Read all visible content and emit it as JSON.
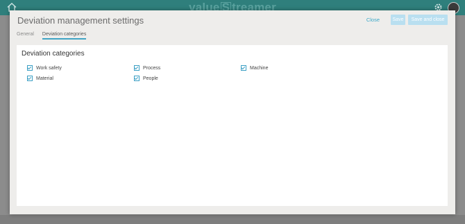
{
  "app": {
    "logo_left": "value",
    "logo_mid": "S",
    "logo_right": "treamer"
  },
  "modal": {
    "title": "Deviation management settings",
    "close_label": "Close",
    "save_label": "Save",
    "save_close_label": "Save and close",
    "tabs": [
      {
        "label": "General",
        "active": false
      },
      {
        "label": "Deviation categories",
        "active": true
      }
    ],
    "section_title": "Deviation categories",
    "categories": [
      {
        "label": "Work safety",
        "checked": true
      },
      {
        "label": "Process",
        "checked": true
      },
      {
        "label": "Machine",
        "checked": true
      },
      {
        "label": "Material",
        "checked": true
      },
      {
        "label": "People",
        "checked": true
      }
    ]
  },
  "colors": {
    "accent": "#3ba8c8",
    "topbar": "#2f7f7c",
    "button_disabled": "#b9dff0"
  },
  "icons": [
    "home-icon",
    "gear-icon",
    "avatar",
    "checkbox-checked-icon"
  ]
}
